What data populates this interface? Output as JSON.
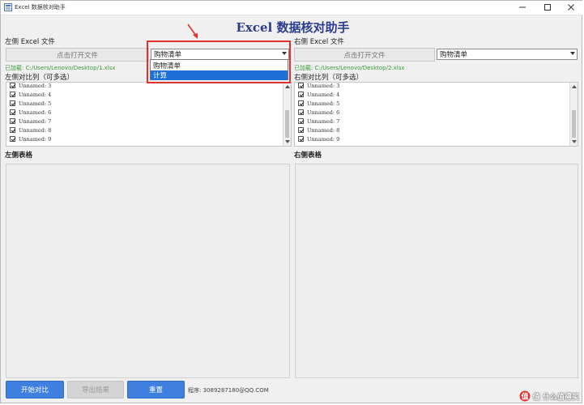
{
  "window": {
    "title": "Excel 数据核对助手",
    "heading": "Excel 数据核对助手"
  },
  "left": {
    "file_label": "左侧 Excel 文件",
    "open_button": "点击打开文件",
    "sheet_selected": "购物清单",
    "loaded": "已加载: C:/Users/Lenovo/Desktop/1.xlsx",
    "columns_label": "左侧对比列（可多选）",
    "columns": [
      "Unnamed: 3",
      "Unnamed: 4",
      "Unnamed: 5",
      "Unnamed: 6",
      "Unnamed: 7",
      "Unnamed: 8",
      "Unnamed: 9"
    ],
    "table_label": "左侧表格"
  },
  "right": {
    "file_label": "右侧 Excel 文件",
    "open_button": "点击打开文件",
    "sheet_selected": "购物清单",
    "loaded": "已加载: C:/Users/Lenovo/Desktop/2.xlsx",
    "columns_label": "右侧对比列（可多选）",
    "columns": [
      "Unnamed: 3",
      "Unnamed: 4",
      "Unnamed: 5",
      "Unnamed: 6",
      "Unnamed: 7",
      "Unnamed: 8",
      "Unnamed: 9"
    ],
    "table_label": "右侧表格"
  },
  "dropdown": {
    "options": [
      "购物清单",
      "计算"
    ],
    "highlighted_index": 1
  },
  "actions": {
    "start": "开始对比",
    "export": "导出结果",
    "reset": "重置"
  },
  "footer": {
    "contact": "程序: 3089287180@QQ.COM"
  },
  "watermark": {
    "text": "值 什么值得买"
  },
  "colors": {
    "accent_blue": "#3f7fe0",
    "heading": "#2a3b8f",
    "loaded_green": "#3a9a3a",
    "highlight_red": "#e03030",
    "dropdown_selection": "#1e6fd6"
  }
}
